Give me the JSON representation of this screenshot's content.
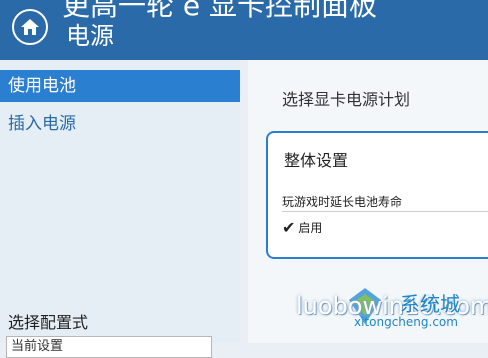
{
  "header": {
    "top_text": "更高一轮 e 显卡控制面板",
    "title": "电源",
    "home_icon": "home-icon"
  },
  "sidebar": {
    "items": [
      {
        "label": "使用电池",
        "active": true
      },
      {
        "label": "插入电源",
        "active": false
      }
    ],
    "profile_label": "选择配置式",
    "profile_value": "当前设置"
  },
  "main": {
    "section_title": "选择显卡电源计划",
    "card": {
      "title": "整体设置",
      "setting_label": "玩游戏时延长电池寿命",
      "setting_value": "启用"
    }
  },
  "watermark": {
    "text": "luobowin10.com",
    "brand": "系统城",
    "sub": "xitongcheng.com"
  },
  "colors": {
    "header": "#2b6aa8",
    "accent": "#2b7fd0",
    "sidebar_bg": "#e5eef4"
  }
}
